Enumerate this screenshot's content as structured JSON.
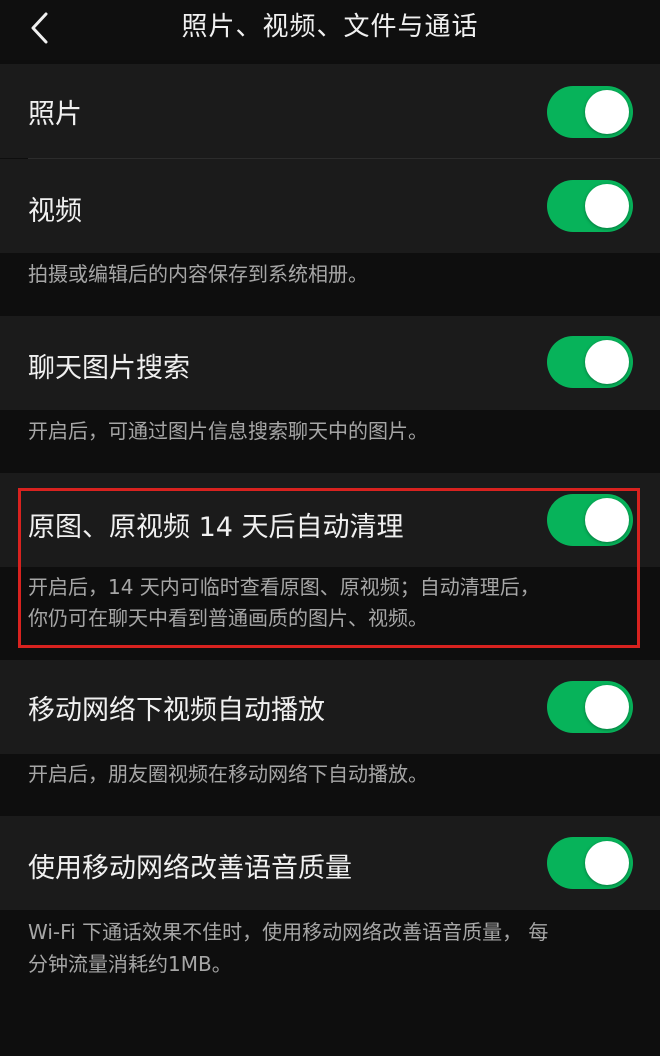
{
  "nav": {
    "title": "照片、视频、文件与通话",
    "back_icon": "chevron-left-icon"
  },
  "settings": [
    {
      "label": "照片",
      "toggle_on": true
    },
    {
      "label": "视频",
      "toggle_on": true,
      "description": "拍摄或编辑后的内容保存到系统相册。"
    },
    {
      "label": "聊天图片搜索",
      "toggle_on": true,
      "description": "开启后，可通过图片信息搜索聊天中的图片。"
    },
    {
      "label": "原图、原视频 14 天后自动清理",
      "toggle_on": true,
      "description_line1": "开启后，14 天内可临时查看原图、原视频；自动清理后，",
      "description_line2": "你仍可在聊天中看到普通画质的图片、视频。",
      "highlighted": true
    },
    {
      "label": "移动网络下视频自动播放",
      "toggle_on": true,
      "description": "开启后，朋友圈视频在移动网络下自动播放。"
    },
    {
      "label": "使用移动网络改善语音质量",
      "toggle_on": true,
      "description_line1": "Wi-Fi 下通话效果不佳时，使用移动网络改善语音质量， 每",
      "description_line2": "分钟流量消耗约1MB。"
    }
  ],
  "colors": {
    "toggle_on": "#07b35a",
    "highlight_border": "#d8221f",
    "background": "#0e0e0e",
    "row_background": "#1b1b1b"
  }
}
